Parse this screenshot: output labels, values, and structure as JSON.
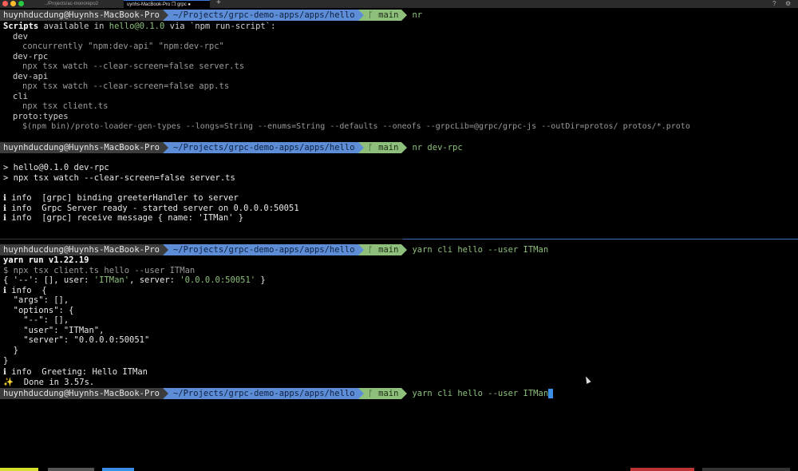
{
  "tabs": [
    {
      "label": "../Projects/ac-monorepo2",
      "active": false
    },
    {
      "label": "uynhs-MacBook-Pro ❐ grpc ●",
      "active": true
    }
  ],
  "new_tab_label": "+",
  "window_buttons": [
    "?",
    "⚙"
  ],
  "prompt": {
    "user": "huynhducdung@Huynhs-MacBook-Pro",
    "dir": "~/Projects/grpc-demo-apps/apps/hello",
    "git": "ᚴ main"
  },
  "pane1": {
    "command": "nr",
    "lines": {
      "scripts_head": "Scripts",
      "scripts_mid": " available in ",
      "scripts_pkg": "hello@0.1.0",
      "scripts_tail": " via `npm run-script`:",
      "s1": "dev",
      "s1c": "concurrently \"npm:dev-api\" \"npm:dev-rpc\"",
      "s2": "dev-rpc",
      "s2c": "npx tsx watch --clear-screen=false server.ts",
      "s3": "dev-api",
      "s3c": "npx tsx watch --clear-screen=false app.ts",
      "s4": "cli",
      "s4c": "npx tsx client.ts",
      "s5": "proto:types",
      "s5c": "$(npm bin)/proto-loader-gen-types --longs=String --enums=String --defaults --oneofs --grpcLib=@grpc/grpc-js --outDir=protos/ protos/*.proto"
    }
  },
  "pane2": {
    "command": "nr dev-rpc",
    "lines": {
      "l1": "> hello@0.1.0 dev-rpc",
      "l2": "> npx tsx watch --clear-screen=false server.ts",
      "l3": "ℹ info  [grpc] binding greeterHandler to server",
      "l4": "ℹ info  Grpc Server ready - started server on 0.0.0.0:50051",
      "l5": "ℹ info  [grpc] receive message { name: 'ITMan' }"
    }
  },
  "pane3": {
    "command": "yarn cli hello --user ITMan",
    "lines": {
      "yarn": "yarn run v1.22.19",
      "npx": "$ npx tsx client.ts hello --user ITMan",
      "obj_a": "{ '--': [], user: ",
      "obj_user": "'ITMan'",
      "obj_b": ", server: ",
      "obj_server": "'0.0.0.0:50051'",
      "obj_c": " }",
      "j1": "ℹ info  {",
      "j2": "  \"args\": [],",
      "j3": "  \"options\": {",
      "j4": "    \"--\": [],",
      "j5": "    \"user\": \"ITMan\",",
      "j6": "    \"server\": \"0.0.0.0:50051\"",
      "j7": "  }",
      "j8": "}",
      "greet": "ℹ info  Greeting: Hello ITMan",
      "done": "✨  Done in 3.57s."
    },
    "current_input": "yarn cli hello --user ITMan"
  },
  "colors": {
    "user_seg": "#3c3c3c",
    "dir_seg": "#5c8dd6",
    "git_seg": "#8ec07c",
    "cursor": "#3a8ee6",
    "active_divider": "#3b6fb5"
  }
}
